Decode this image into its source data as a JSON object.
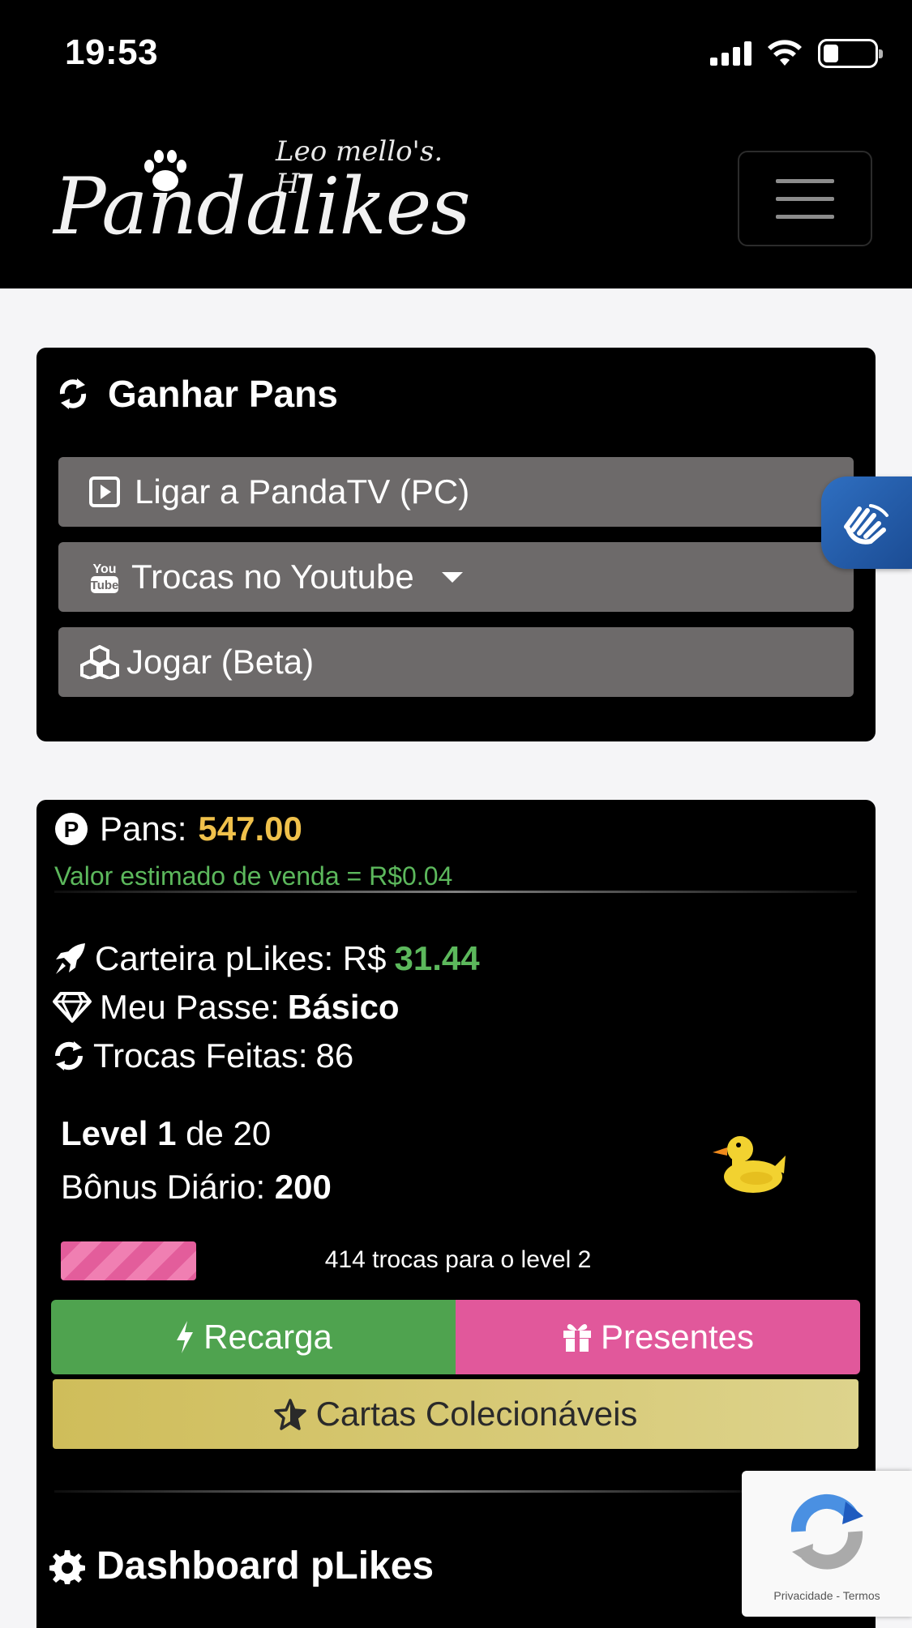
{
  "status_bar": {
    "time": "19:53"
  },
  "header": {
    "logo_script": "Leo mello's. H",
    "logo_main": "Pandalikes"
  },
  "earn_card": {
    "title": "Ganhar Pans",
    "buttons": [
      {
        "label": "Ligar a PandaTV (PC)",
        "icon": "play-square-icon"
      },
      {
        "label": "Trocas no Youtube",
        "icon": "youtube-icon"
      },
      {
        "label": "Jogar (Beta)",
        "icon": "cubes-icon"
      }
    ]
  },
  "wallet_card": {
    "pans_label": "Pans:",
    "pans_value": "547.00",
    "estimate": "Valor estimado de venda = R$0.04",
    "carteira_label": "Carteira pLikes: R$",
    "carteira_value": "31.44",
    "passe_label": "Meu Passe:",
    "passe_value": "Básico",
    "trocas_label": "Trocas Feitas:",
    "trocas_value": "86",
    "level_label": "Level 1",
    "level_rest": "de 20",
    "bonus_label": "Bônus Diário:",
    "bonus_value": "200",
    "progress_fraction": 0.17,
    "progress_text": "414 trocas para o level 2",
    "recarga_label": "Recarga",
    "presentes_label": "Presentes",
    "cartas_label": "Cartas Colecionáveis",
    "dashboard_title": "Dashboard pLikes"
  },
  "recaptcha": {
    "links": "Privacidade - Termos"
  },
  "colors": {
    "gold": "#f0c14b",
    "green": "#5cb85c",
    "pink": "#e1589b",
    "button_gray": "#6d6a6a"
  }
}
